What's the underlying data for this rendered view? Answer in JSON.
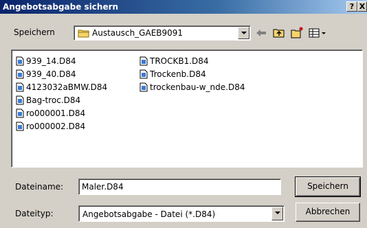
{
  "window": {
    "title": "Angebotsabgabe sichern",
    "help_label": "?",
    "close_label": "X"
  },
  "toolbar": {
    "lookin_label": "Speichern",
    "lookin_value": "Austausch_GAEB9091"
  },
  "files": {
    "column1": [
      "939_14.D84",
      "939_40.D84",
      "4123032aBMW.D84",
      "Bag-troc.D84",
      "ro000001.D84",
      "ro000002.D84"
    ],
    "column2": [
      "TROCKB1.D84",
      "Trockenb.D84",
      "trockenbau-w_nde.D84"
    ]
  },
  "form": {
    "filename_label": "Dateiname:",
    "filename_value": "Maler.D84",
    "filetype_label": "Dateityp:",
    "filetype_value": "Angebotsabgabe - Datei (*.D84)"
  },
  "buttons": {
    "save_label": "Speichern",
    "cancel_label": "Abbrechen"
  },
  "colors": {
    "title_start": "#0a246a",
    "title_end": "#a6caf0",
    "dialog_bg": "#d4d0c8",
    "folder_yellow": "#f5d46b"
  }
}
